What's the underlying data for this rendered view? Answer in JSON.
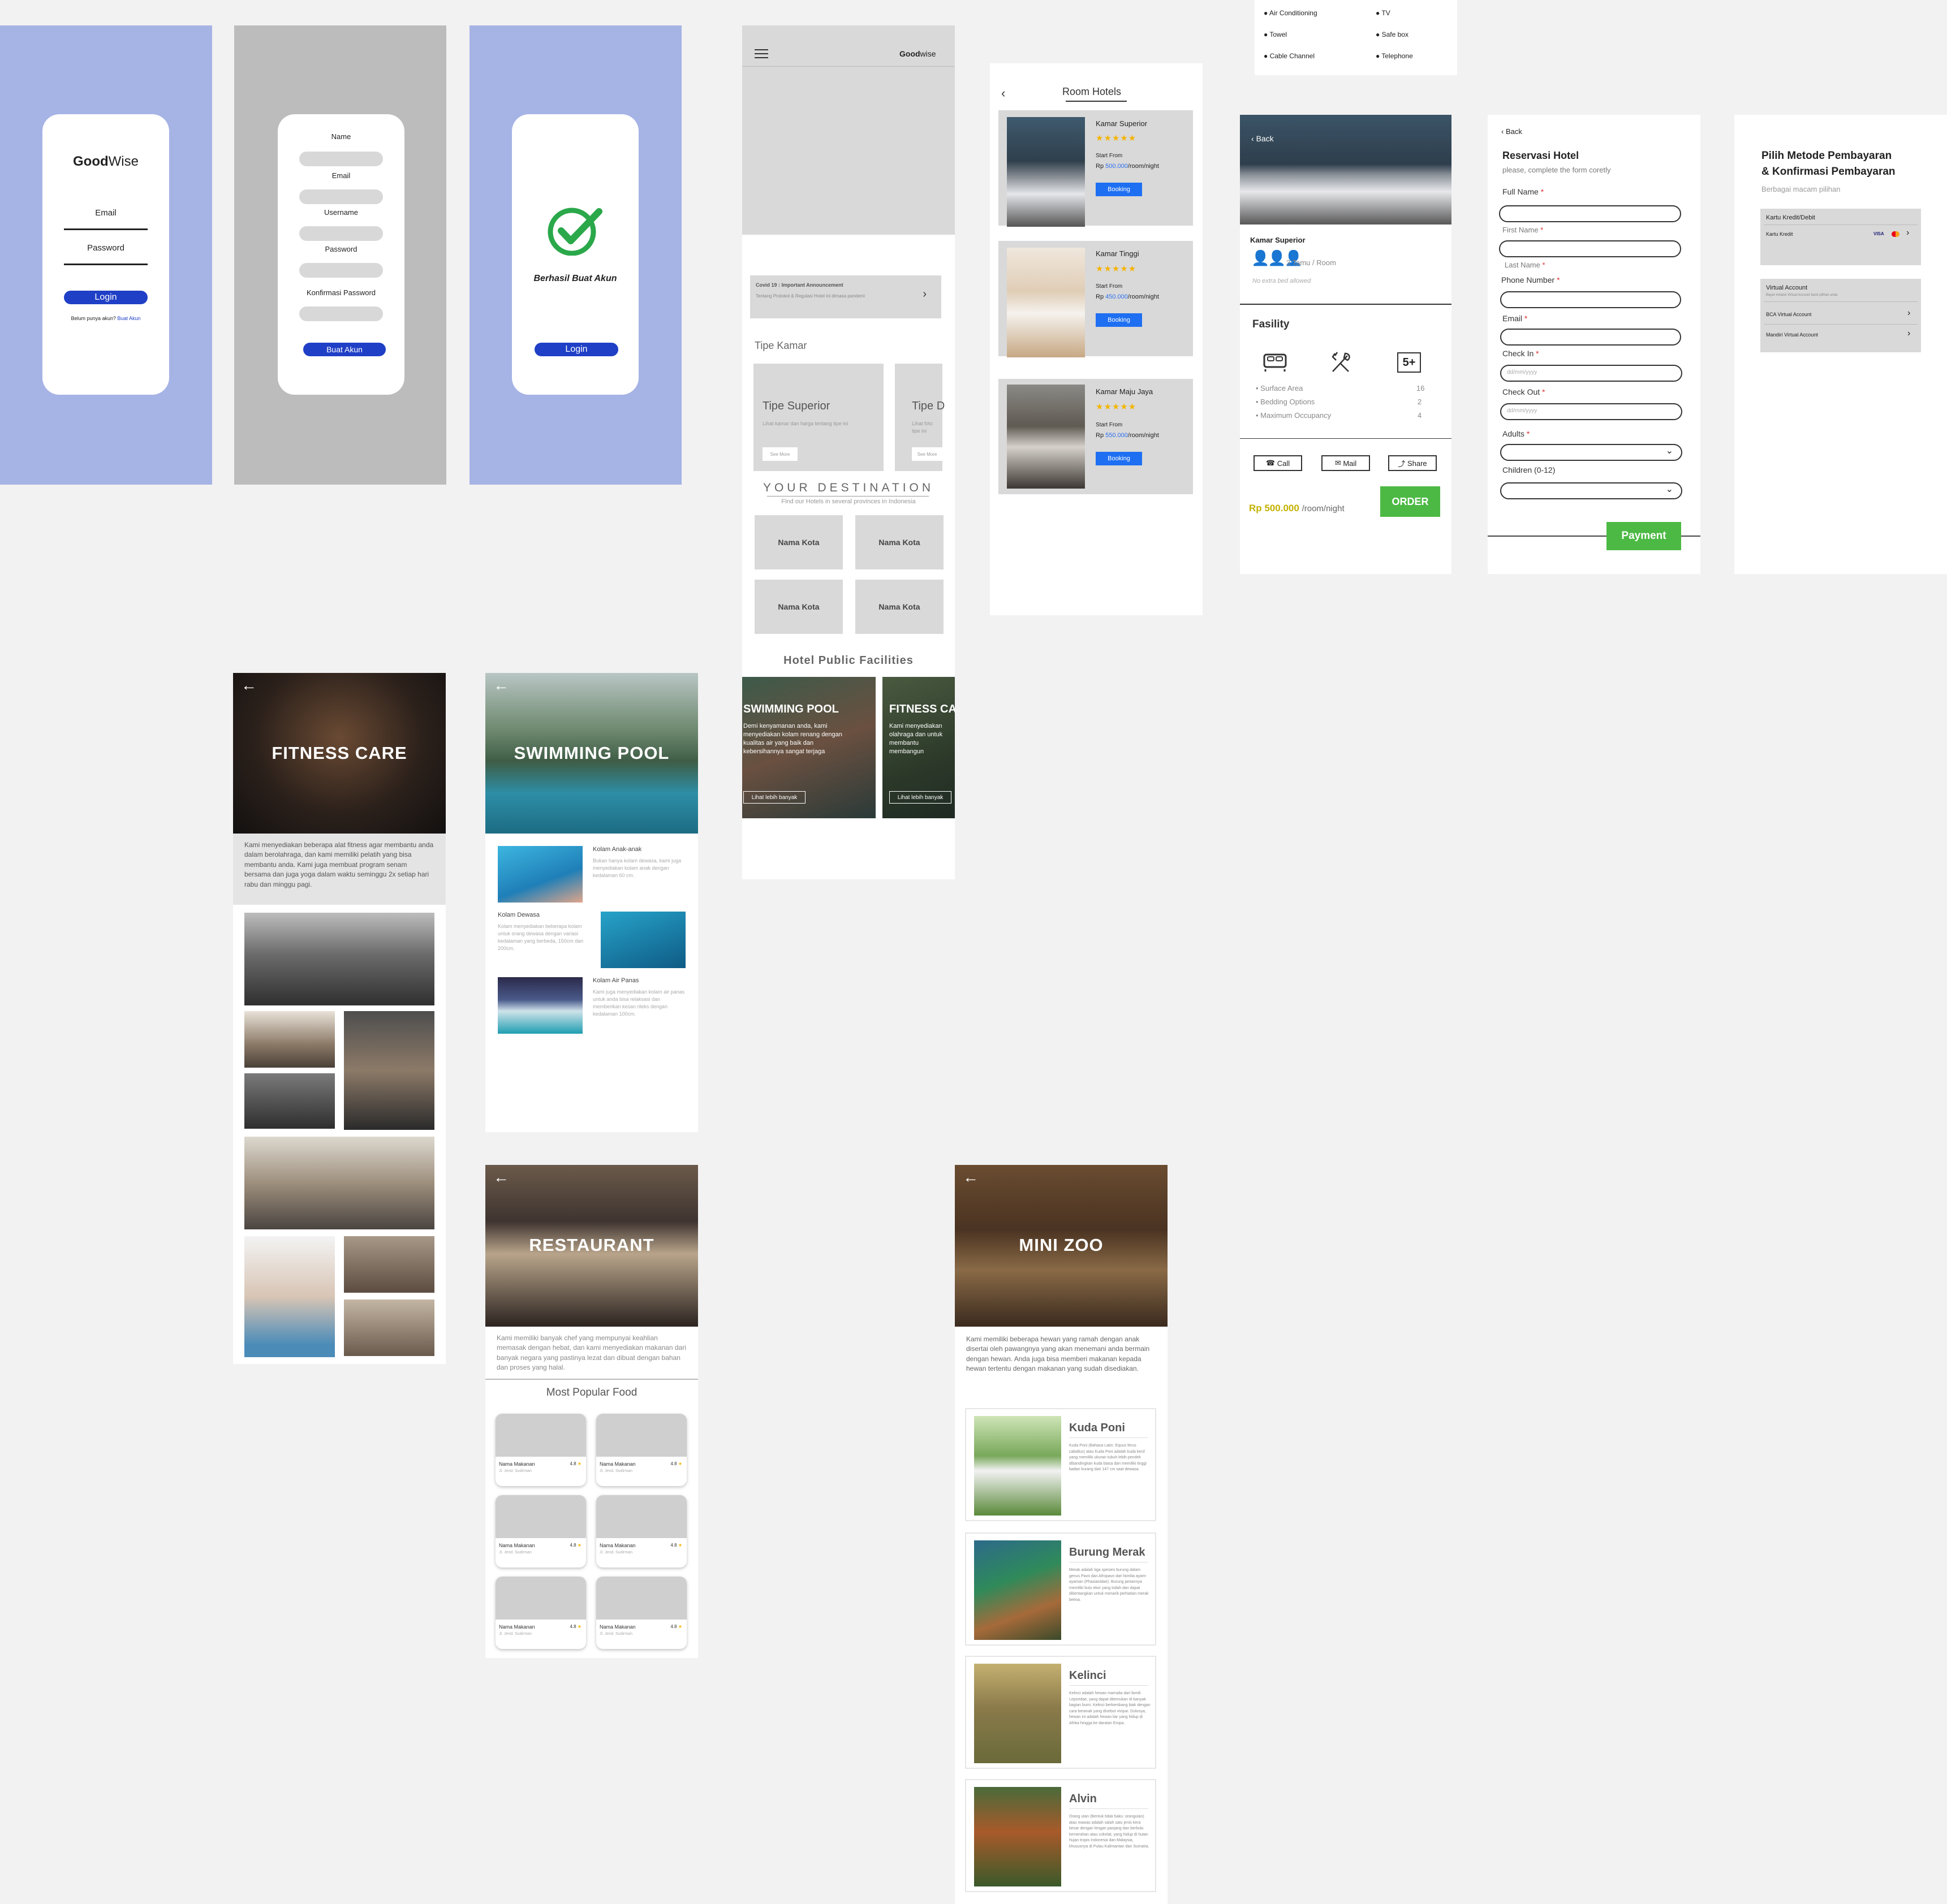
{
  "login": {
    "logo_bold": "Good",
    "logo_light": "Wise",
    "email_label": "Email",
    "password_label": "Password",
    "login_button": "Login",
    "signup_prompt": "Belum punya akun?",
    "signup_link": "Buat Akun"
  },
  "register": {
    "name": "Name",
    "email": "Email",
    "username": "Username",
    "password": "Password",
    "confirm": "Konfirmasi Password",
    "submit": "Buat Akun"
  },
  "success": {
    "message": "Berhasil Buat Akun",
    "login_button": "Login"
  },
  "home": {
    "logo_bold": "Good",
    "logo_light": "wise",
    "announcement_title": "Covid 19 : Important Announcement",
    "announcement_text": "Tentang Protokol & Regulasi Hotel ini dimasa pandemi",
    "room_type_heading": "Tipe Kamar",
    "room_card_1": "Tipe Superior",
    "room_card_1_text": "Lihat kamar dan harga tentang tipe ini",
    "room_card_2": "Tipe D",
    "room_card_2_text": "Lihat foto tipe ini",
    "see_more": "See More",
    "dest_heading": "YOUR DESTINATION",
    "dest_sub": "Find our Hotels in several provinces in Indonesia",
    "cities": [
      "Nama Kota",
      "Nama Kota",
      "Nama Kota",
      "Nama Kota"
    ],
    "facilities_heading": "Hotel Public Facilities",
    "fac_1_title": "SWIMMING POOL",
    "fac_1_text": "Demi kenyamanan anda, kami menyediakan kolam renang dengan kualitas air yang baik dan kebersihannya sangat terjaga",
    "fac_2_title": "FITNESS CA",
    "fac_2_text": "Kami menyediakan olahraga dan untuk membantu membangun",
    "fac_button": "Lihat lebih banyak"
  },
  "rooms": {
    "title": "Room Hotels",
    "start_from": "Start From",
    "currency": "Rp",
    "unit": "/room/night",
    "booking": "Booking",
    "items": [
      {
        "name": "Kamar Superior",
        "price": "500.000"
      },
      {
        "name": "Kamar Tinggi",
        "price": "450.000"
      },
      {
        "name": "Kamar Maju Jaya",
        "price": "550.000"
      }
    ]
  },
  "amenities": [
    "Air Conditioning",
    "TV",
    "Towel",
    "Safe box",
    "Cable Channel",
    "Telephone"
  ],
  "detail": {
    "back": "Back",
    "room_name": "Kamar Superior",
    "guests": "3 Tamu / Room",
    "extra_bed": "No extra bed allowed",
    "facility_heading": "Fasility",
    "five_plus": "5+",
    "rows": [
      {
        "label": "Surface Area",
        "value": "16"
      },
      {
        "label": "Bedding Options",
        "value": "2"
      },
      {
        "label": "Maximum Occupancy",
        "value": "4"
      }
    ],
    "call": "Call",
    "mail": "Mail",
    "share": "Share",
    "price": "Rp 500.000",
    "unit": "/room/night",
    "order": "ORDER"
  },
  "reservation": {
    "back": "Back",
    "title": "Reservasi Hotel",
    "subtitle": "please,  complete the form coretly",
    "full_name": "Full Name",
    "first_name": "First Name",
    "last_name": "Last Name",
    "phone": "Phone Number",
    "email": "Email",
    "check_in": "Check In",
    "check_out": "Check Out",
    "date_placeholder": "dd/mm/yyyy",
    "adults": "Adults",
    "children": "Children (0-12)",
    "payment": "Payment",
    "star": "*"
  },
  "payment": {
    "title_1": "Pilih Metode Pembayaran",
    "title_2": "& Konfirmasi Pembayaran",
    "subtitle": "Berbagai macam pilihan",
    "card_group": "Kartu Kredit/Debit",
    "card_item": "Kartu Kredit",
    "card_brand": "VISA",
    "va_group": "Virtual Account",
    "va_desc": "Bayar melalui Virtual Account bank pilihan anda",
    "va_items": [
      "BCA Virtual Account",
      "Mandiri Virtual Account"
    ]
  },
  "fitness": {
    "title": "FITNESS CARE",
    "text": "Kami menyediakan beberapa alat fitness agar membantu anda dalam berolahraga, dan kami memiliki pelatih yang bisa membantu anda. Kami juga membuat program senam bersama dan juga yoga dalam waktu seminggu 2x setiap hari rabu dan minggu pagi."
  },
  "pool": {
    "title": "SWIMMING POOL",
    "items": [
      {
        "name": "Kolam Anak-anak",
        "text": "Bukan hanya kolam dewasa, kami juga menyediakan kolam anak dengan kedalaman 60 cm."
      },
      {
        "name": "Kolam Dewasa",
        "text": "Kolam menyediakan beberapa kolam untuk orang dewasa dengan variasi kedalaman yang berbeda, 150cm dan 200cm."
      },
      {
        "name": "Kolam Air Panas",
        "text": "Kami juga menyediakan kolam air panas untuk anda bisa relaksasi dan memberikan kesan rileks dengan kedalaman 100cm."
      }
    ]
  },
  "restaurant": {
    "title": "RESTAURANT",
    "text": "Kami memiliki banyak chef yang mempunyai keahlian memasak dengan hebat, dan kami menyediakan makanan dari banyak negara yang pastinya lezat dan dibuat dengan bahan dan proses yang halal.",
    "popular": "Most Popular Food",
    "food_name": "Nama Makanan",
    "rating": "4.8",
    "food_address": "Jl. Jend. Sudirman"
  },
  "zoo": {
    "title": "MINI ZOO",
    "text": "Kami memiliki beberapa hewan yang ramah dengan anak disertai oleh pawangnya yang akan menemani anda bermain dengan hewan. Anda juga bisa memberi makanan kepada hewan tertentu dengan makanan yang sudah disediakan.",
    "animals": [
      {
        "name": "Kuda Poni",
        "text": "Kuda Poni (Bahasa Latin: Equus ferus caballus) atau Kuda Poni adalah kuda kecil yang memiliki ukuran tubuh lebih pendek dibandingkan kuda biasa dan memiliki tinggi badan kurang dari 147 cm saat dewasa."
      },
      {
        "name": "Burung Merak",
        "text": "Merak adalah tiga spesies burung dalam genus Pavo dan Afropavo dari familia ayam-ayaman (Phasianidae). Burung jantannya memiliki bulu ekor yang indah dan dapat dibentangkan untuk menarik perhatian merak betina."
      },
      {
        "name": "Kelinci",
        "text": "Kelinci adalah hewan mamalia dari famili Leporidae, yang dapat ditemukan di banyak bagian bumi. Kelinci berkembang biak dengan cara beranak yang disebut vivipar. Dulunya, hewan ini adalah hewan liar yang hidup di Afrika hingga ke daratan Eropa."
      },
      {
        "name": "Alvin",
        "text": "Orang utan (Bentuk tidak baku: orangutan) atau mawas adalah salah satu jenis kera besar dengan lengan panjang dan berbulu kemerahan atau cokelat, yang hidup di hutan hujan tropis Indonesia dan Malaysia, khususnya di Pulau Kalimantan dan Sumatra."
      }
    ]
  },
  "colors": {
    "accent_blue": "#1f3fc6",
    "booking_blue": "#1e6ff2",
    "order_green": "#4cb944",
    "login_bg": "#a6b3e5",
    "star_yellow": "#f5b400"
  }
}
